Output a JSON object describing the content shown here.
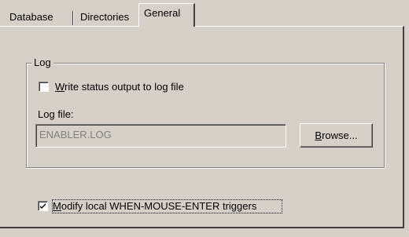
{
  "tabs": [
    {
      "label": "Database",
      "active": false
    },
    {
      "label": "Directories",
      "active": false
    },
    {
      "label": "General",
      "active": true
    }
  ],
  "log_group": {
    "title": "Log",
    "write_status": {
      "label_mnemonic": "W",
      "label_rest": "rite status output to log file",
      "checked": false
    },
    "log_file": {
      "label_prefix": "Lo",
      "label_mnemonic": "g",
      "label_rest": " file:",
      "value": "ENABLER.LOG",
      "enabled": false
    },
    "browse_button": {
      "label_mnemonic": "B",
      "label_rest": "rowse..."
    }
  },
  "modify_triggers": {
    "label_mnemonic": "M",
    "label_rest": "odify local WHEN-MOUSE-ENTER triggers",
    "checked": true
  }
}
